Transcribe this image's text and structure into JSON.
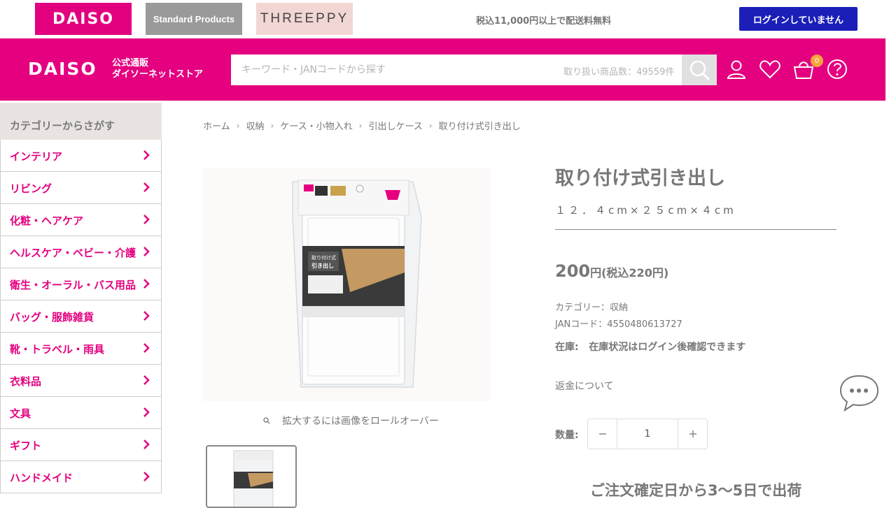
{
  "topbar": {
    "brands": [
      "DAISO",
      "Standard Products",
      "THREEPPY"
    ],
    "free_shipping": "税込11,000円以上で配送料無料",
    "login_label": "ログインしていません"
  },
  "header": {
    "logo": "DAISO",
    "logo_sub_line1": "公式通販",
    "logo_sub_line2": "ダイソーネットストア",
    "search_placeholder": "キーワード・JANコードから探す",
    "item_count": "取り扱い商品数：49559件",
    "cart_count": "0",
    "icons": [
      "search-icon",
      "user-icon",
      "heart-icon",
      "cart-icon",
      "help-icon"
    ],
    "accent": "#e4007f"
  },
  "sidebar": {
    "title": "カテゴリーからさがす",
    "items": [
      "インテリア",
      "リビング",
      "化粧・ヘアケア",
      "ヘルスケア・ベビー・介護",
      "衛生・オーラル・バス用品",
      "バッグ・服飾雑貨",
      "靴・トラベル・雨具",
      "衣料品",
      "文具",
      "ギフト",
      "ハンドメイド"
    ]
  },
  "breadcrumb": [
    "ホーム",
    "収納",
    "ケース・小物入れ",
    "引出しケース",
    "取り付け式引き出し"
  ],
  "gallery": {
    "zoom_hint": "拡大するには画像をロールオーバー",
    "package_label_line1": "取り付け式",
    "package_label_line2": "引き出し"
  },
  "product": {
    "title": "取り付け式引き出し",
    "size": "１２．４cm×２５cm×４cm",
    "price": "200",
    "price_suffix": "円(税込220円)",
    "category": "カテゴリー：収納",
    "jan": "JANコード：4550480613727",
    "stock_label": "在庫:",
    "stock_text": "在庫状況はログイン後確認できます",
    "refund": "返金について",
    "qty_label": "数量:",
    "qty_value": "1",
    "shipping_note": "ご注文確定日から3〜5日で出荷"
  }
}
